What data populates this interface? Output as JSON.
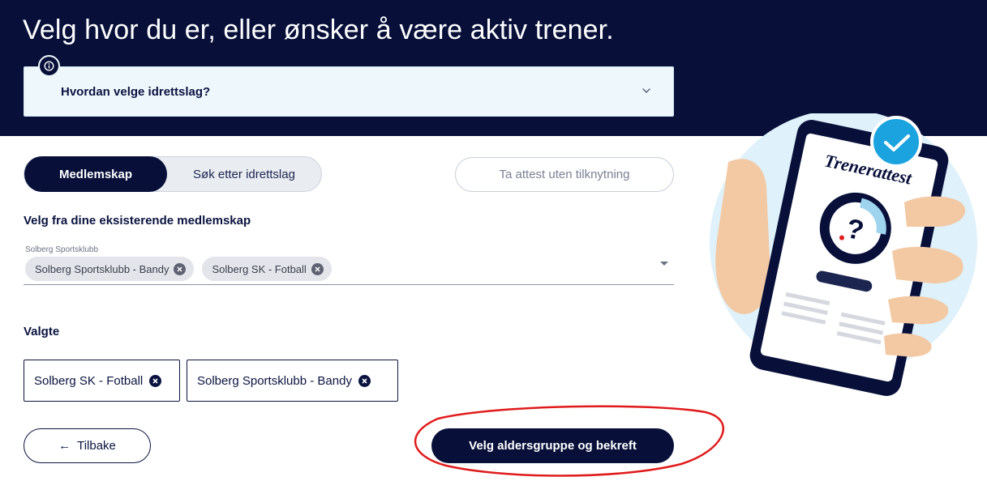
{
  "header": {
    "title": "Velg hvor du er, eller ønsker å være aktiv trener.",
    "info_panel": {
      "label": "Hvordan velge idrettslag?",
      "icon": "info-icon",
      "chevron": "chevron-down-icon"
    }
  },
  "mode_toggle": {
    "active_label": "Medlemskap",
    "inactive_label": "Søk etter idrettslag"
  },
  "attest_button": {
    "label": "Ta attest uten tilknytning"
  },
  "memberships": {
    "heading": "Velg fra dine eksisterende medlemskap",
    "select_label": "Solberg Sportsklubb",
    "chips": [
      {
        "label": "Solberg Sportsklubb - Bandy"
      },
      {
        "label": "Solberg SK - Fotball"
      }
    ]
  },
  "selected": {
    "heading": "Valgte",
    "items": [
      {
        "label": "Solberg SK - Fotball"
      },
      {
        "label": "Solberg Sportsklubb - Bandy"
      }
    ]
  },
  "actions": {
    "back_arrow": "←",
    "back_label": "Tilbake",
    "confirm_label": "Velg aldersgruppe og bekreft"
  },
  "illustration": {
    "phone_title": "Trenerattest",
    "question_mark": "?"
  },
  "colors": {
    "navy": "#08103a",
    "info_bg": "#eef8fc",
    "accent_blue": "#1ba3e0",
    "annotation_red": "#e01b1b"
  }
}
